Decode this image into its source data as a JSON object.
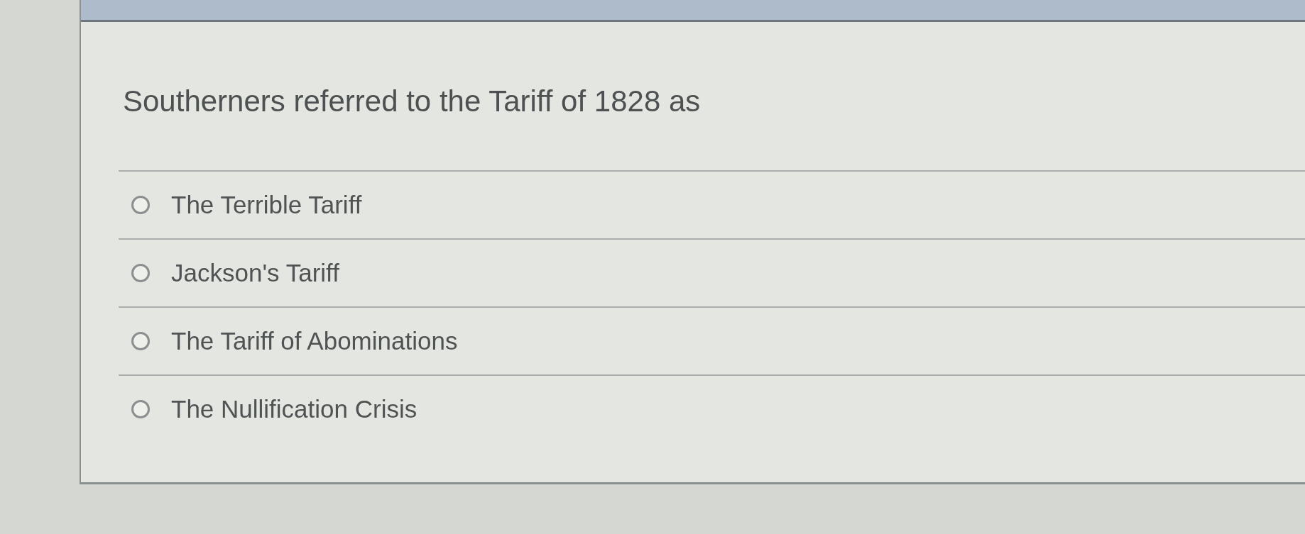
{
  "question": {
    "text": "Southerners referred to the Tariff of 1828 as"
  },
  "options": [
    {
      "label": "The Terrible Tariff",
      "selected": false
    },
    {
      "label": "Jackson's Tariff",
      "selected": false
    },
    {
      "label": "The Tariff of Abominations",
      "selected": false
    },
    {
      "label": "The Nullification Crisis",
      "selected": false
    }
  ]
}
